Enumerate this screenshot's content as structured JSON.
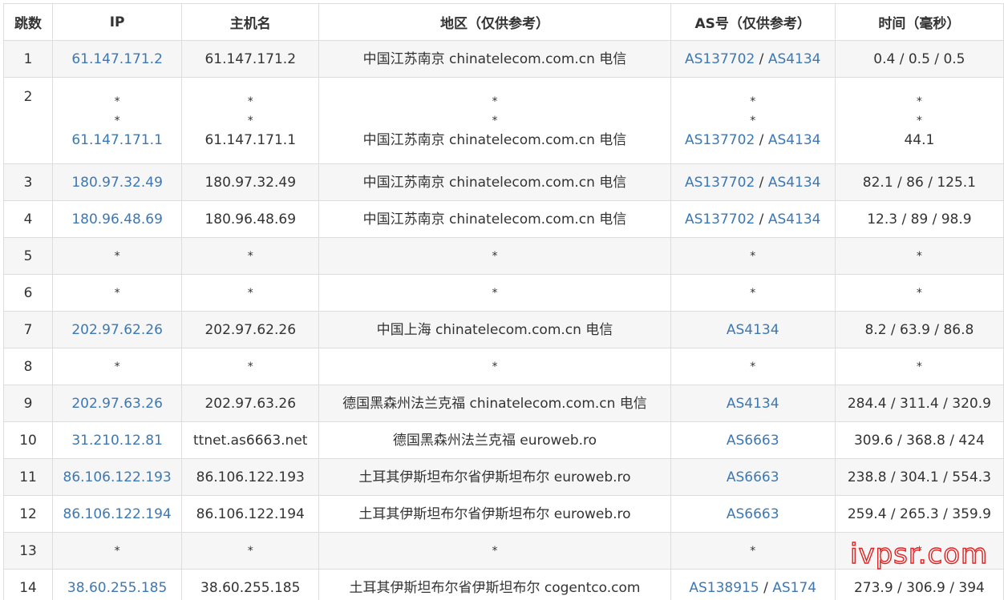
{
  "headers": {
    "hop": "跳数",
    "ip": "IP",
    "host": "主机名",
    "region": "地区（仅供参考）",
    "as": "AS号（仅供参考）",
    "time": "时间（毫秒）"
  },
  "rows": [
    {
      "hop": "1",
      "lines": [
        {
          "ip": "61.147.171.2",
          "host": "61.147.171.2",
          "region": "中国江苏南京 chinatelecom.com.cn 电信",
          "as": [
            "AS137702",
            "AS4134"
          ],
          "time": "0.4 / 0.5 / 0.5"
        }
      ]
    },
    {
      "hop": "2",
      "lines": [
        {
          "ip": "*",
          "host": "*",
          "region": "*",
          "as": [
            "*"
          ],
          "time": "*"
        },
        {
          "ip": "*",
          "host": "*",
          "region": "*",
          "as": [
            "*"
          ],
          "time": "*"
        },
        {
          "ip": "61.147.171.1",
          "host": "61.147.171.1",
          "region": "中国江苏南京 chinatelecom.com.cn 电信",
          "as": [
            "AS137702",
            "AS4134"
          ],
          "time": "44.1"
        }
      ]
    },
    {
      "hop": "3",
      "lines": [
        {
          "ip": "180.97.32.49",
          "host": "180.97.32.49",
          "region": "中国江苏南京 chinatelecom.com.cn 电信",
          "as": [
            "AS137702",
            "AS4134"
          ],
          "time": "82.1 / 86 / 125.1"
        }
      ]
    },
    {
      "hop": "4",
      "lines": [
        {
          "ip": "180.96.48.69",
          "host": "180.96.48.69",
          "region": "中国江苏南京 chinatelecom.com.cn 电信",
          "as": [
            "AS137702",
            "AS4134"
          ],
          "time": "12.3 / 89 / 98.9"
        }
      ]
    },
    {
      "hop": "5",
      "lines": [
        {
          "ip": "*",
          "host": "*",
          "region": "*",
          "as": [
            "*"
          ],
          "time": "*"
        }
      ]
    },
    {
      "hop": "6",
      "lines": [
        {
          "ip": "*",
          "host": "*",
          "region": "*",
          "as": [
            "*"
          ],
          "time": "*"
        }
      ]
    },
    {
      "hop": "7",
      "lines": [
        {
          "ip": "202.97.62.26",
          "host": "202.97.62.26",
          "region": "中国上海 chinatelecom.com.cn 电信",
          "as": [
            "AS4134"
          ],
          "time": "8.2 / 63.9 / 86.8"
        }
      ]
    },
    {
      "hop": "8",
      "lines": [
        {
          "ip": "*",
          "host": "*",
          "region": "*",
          "as": [
            "*"
          ],
          "time": "*"
        }
      ]
    },
    {
      "hop": "9",
      "lines": [
        {
          "ip": "202.97.63.26",
          "host": "202.97.63.26",
          "region": "德国黑森州法兰克福 chinatelecom.com.cn 电信",
          "as": [
            "AS4134"
          ],
          "time": "284.4 / 311.4 / 320.9"
        }
      ]
    },
    {
      "hop": "10",
      "lines": [
        {
          "ip": "31.210.12.81",
          "host": "ttnet.as6663.net",
          "region": "德国黑森州法兰克福 euroweb.ro",
          "as": [
            "AS6663"
          ],
          "time": "309.6 / 368.8 / 424"
        }
      ]
    },
    {
      "hop": "11",
      "lines": [
        {
          "ip": "86.106.122.193",
          "host": "86.106.122.193",
          "region": "土耳其伊斯坦布尔省伊斯坦布尔 euroweb.ro",
          "as": [
            "AS6663"
          ],
          "time": "238.8 / 304.1 / 554.3"
        }
      ]
    },
    {
      "hop": "12",
      "lines": [
        {
          "ip": "86.106.122.194",
          "host": "86.106.122.194",
          "region": "土耳其伊斯坦布尔省伊斯坦布尔 euroweb.ro",
          "as": [
            "AS6663"
          ],
          "time": "259.4 / 265.3 / 359.9"
        }
      ]
    },
    {
      "hop": "13",
      "lines": [
        {
          "ip": "*",
          "host": "*",
          "region": "*",
          "as": [
            "*"
          ],
          "time": "*"
        }
      ]
    },
    {
      "hop": "14",
      "lines": [
        {
          "ip": "38.60.255.185",
          "host": "38.60.255.185",
          "region": "土耳其伊斯坦布尔省伊斯坦布尔 cogentco.com",
          "as": [
            "AS138915",
            "AS174"
          ],
          "time": "273.9 / 306.9 / 394"
        }
      ]
    }
  ],
  "watermark": "ivpsr.com",
  "colors": {
    "link": "#3c78b4",
    "text": "#333333",
    "stripe": "#f6f6f6",
    "border": "#dddddd",
    "watermark": "#e02020"
  }
}
